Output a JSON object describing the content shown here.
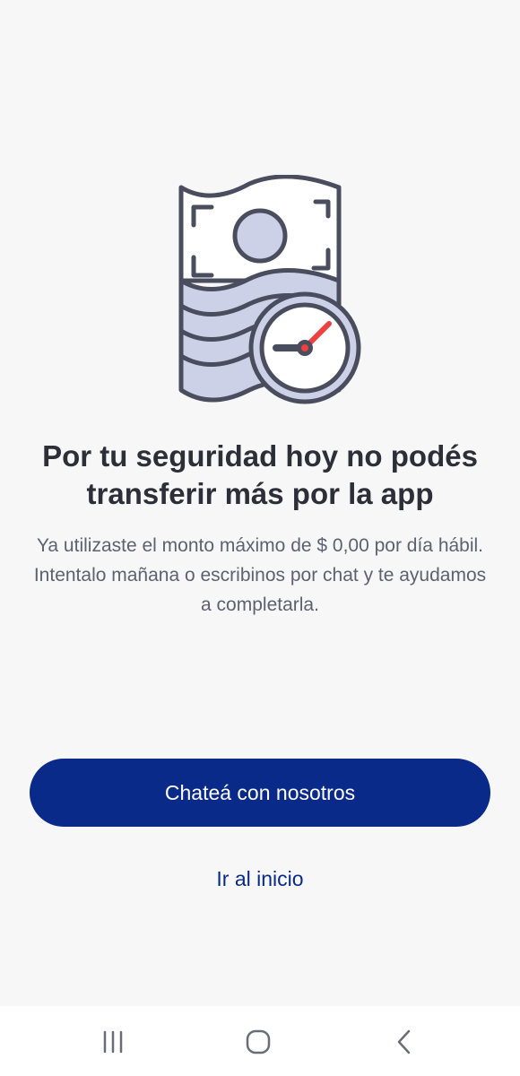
{
  "illustration": {
    "icon": "money-clock-icon",
    "colors": {
      "stroke": "#4a4d5e",
      "fill_light": "#ffffff",
      "fill_accent": "#cdd1e8",
      "clock_hand_accent": "#ef4040"
    }
  },
  "message": {
    "title": "Por tu seguridad hoy no podés transferir más por la app",
    "body": "Ya utilizaste el monto máximo de $ 0,00 por día hábil. Intentalo mañana o escribinos por chat y te ayudamos a completarla."
  },
  "actions": {
    "chat_label": "Chateá con nosotros",
    "home_label": "Ir al inicio"
  },
  "navbar": {
    "items": [
      {
        "icon": "recent-apps-icon"
      },
      {
        "icon": "home-icon"
      },
      {
        "icon": "back-icon"
      }
    ]
  },
  "colors": {
    "background": "#f7f7f8",
    "primary": "#0a2a8a",
    "title_text": "#2c2f38",
    "body_text": "#5d6170"
  }
}
